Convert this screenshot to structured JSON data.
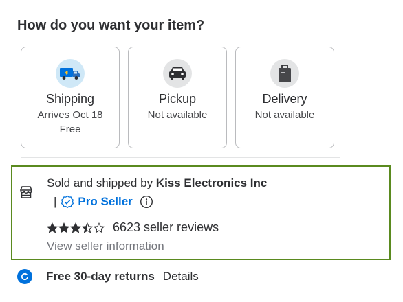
{
  "heading": "How do you want your item?",
  "fulfillment_options": [
    {
      "label": "Shipping",
      "line1": "Arrives Oct 18",
      "line2": "Free",
      "icon": "delivery-truck-icon"
    },
    {
      "label": "Pickup",
      "line1": "Not available",
      "line2": "",
      "icon": "car-icon"
    },
    {
      "label": "Delivery",
      "line1": "Not available",
      "line2": "",
      "icon": "shopping-bag-icon"
    }
  ],
  "seller": {
    "sold_by_prefix": "Sold and shipped by ",
    "seller_name": "Kiss Electronics Inc",
    "pipe": "|",
    "pro_seller_label": "Pro Seller",
    "rating_stars": 3.5,
    "reviews_text": "6623 seller reviews",
    "view_link": "View seller information",
    "icon": "store-icon"
  },
  "returns": {
    "text": "Free 30-day returns",
    "link": "Details",
    "icon": "returns-icon"
  },
  "colors": {
    "accent_blue": "#0071dc",
    "seller_border": "#5a8a1f",
    "card_border": "#babbbe"
  }
}
